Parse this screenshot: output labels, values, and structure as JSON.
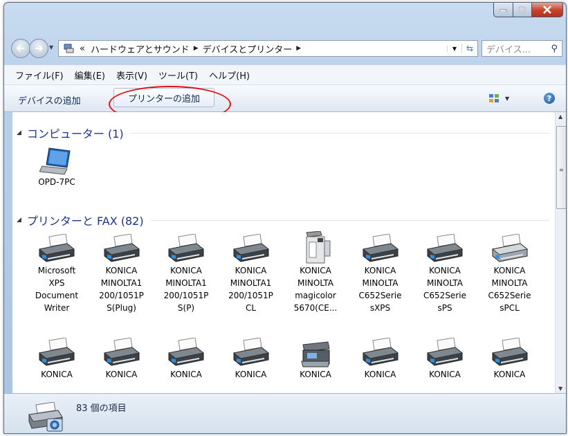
{
  "window": {
    "minimize_icon": "minimize-icon",
    "maximize_icon": "maximize-icon",
    "close_icon": "close-icon"
  },
  "address": {
    "overflow": "«",
    "segments": [
      "ハードウェアとサウンド",
      "デバイスとプリンター"
    ]
  },
  "search": {
    "placeholder": "デバイス..."
  },
  "menu": [
    "ファイル(F)",
    "編集(E)",
    "表示(V)",
    "ツール(T)",
    "ヘルプ(H)"
  ],
  "toolbar": {
    "add_device": "デバイスの追加",
    "add_printer": "プリンターの追加"
  },
  "groups": {
    "computer": {
      "title": "コンピューター (1)",
      "items": [
        {
          "label": "OPD-7PC",
          "icon": "laptop"
        }
      ]
    },
    "printers": {
      "title": "プリンターと FAX (82)",
      "items": [
        {
          "label": "Microsoft\nXPS\nDocument\nWriter",
          "icon": "printer"
        },
        {
          "label": "KONICA\nMINOLTA1\n200/1051P\nS(Plug)",
          "icon": "printer"
        },
        {
          "label": "KONICA\nMINOLTA1\n200/1051P\nS(P)",
          "icon": "printer"
        },
        {
          "label": "KONICA\nMINOLTA1\n200/1051P\nCL",
          "icon": "printer"
        },
        {
          "label": "KONICA\nMINOLTA\nmagicolor\n5670(CE...",
          "icon": "copier"
        },
        {
          "label": "KONICA\nMINOLTA\nC652Serie\nsXPS",
          "icon": "printer"
        },
        {
          "label": "KONICA\nMINOLTA\nC652Serie\nsPS",
          "icon": "printer"
        },
        {
          "label": "KONICA\nMINOLTA\nC652Serie\nsPCL",
          "icon": "printer-gray"
        },
        {
          "label": "KONICA",
          "icon": "printer"
        },
        {
          "label": "KONICA",
          "icon": "printer"
        },
        {
          "label": "KONICA",
          "icon": "printer"
        },
        {
          "label": "KONICA",
          "icon": "printer"
        },
        {
          "label": "KONICA",
          "icon": "mfp"
        },
        {
          "label": "KONICA",
          "icon": "printer"
        },
        {
          "label": "KONICA",
          "icon": "printer"
        },
        {
          "label": "KONICA",
          "icon": "printer"
        }
      ]
    }
  },
  "status": {
    "count_text": "83 個の項目"
  },
  "colors": {
    "group_title": "#1e3287",
    "annotation": "#e01010"
  }
}
